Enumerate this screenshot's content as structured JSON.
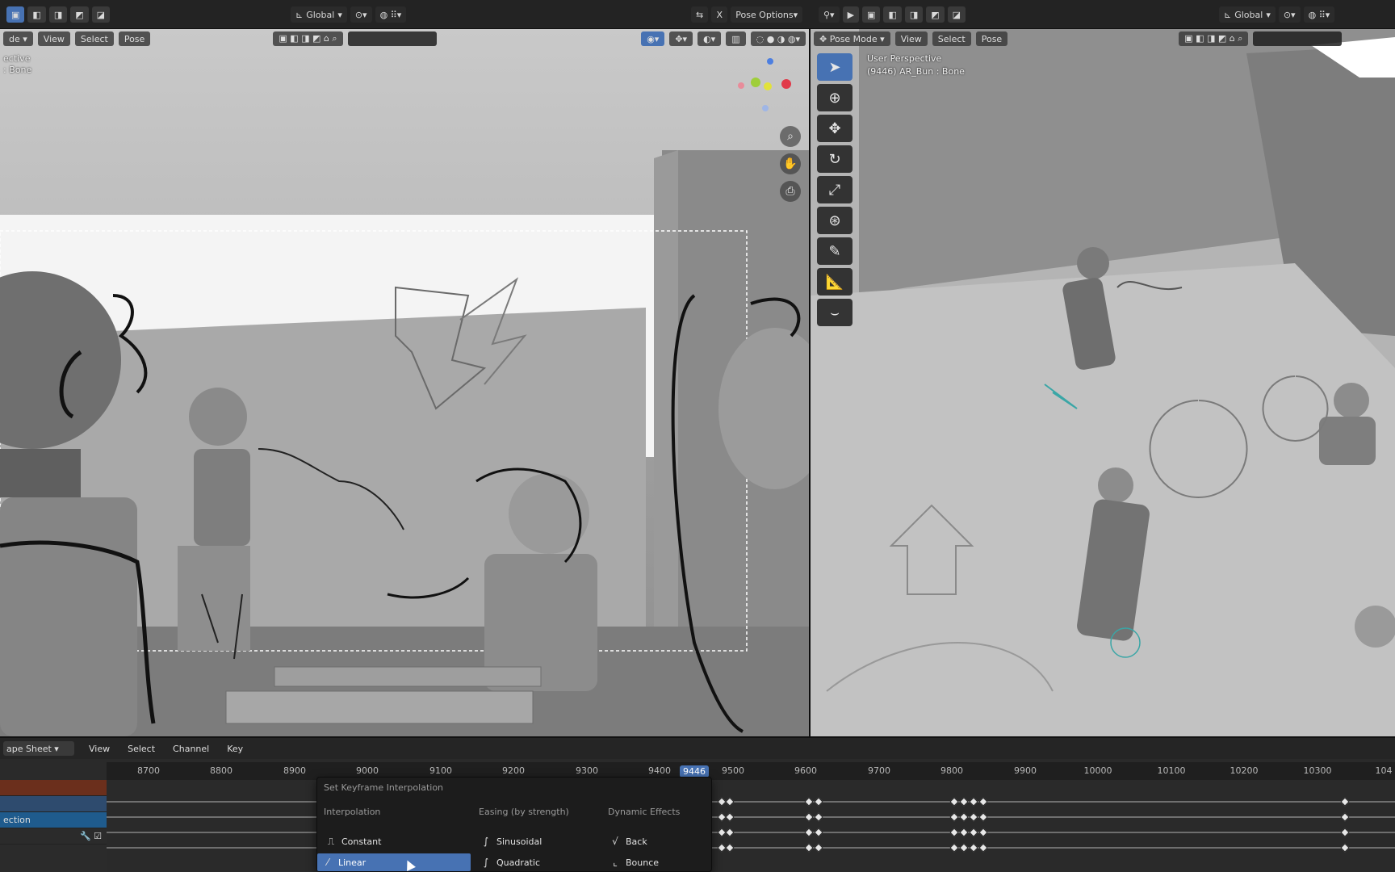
{
  "topbar": {
    "left_orientation": "Global",
    "left_pose_options": "Pose Options",
    "right_orientation": "Global"
  },
  "left_viewport": {
    "header": {
      "mode": "de",
      "view": "View",
      "select": "Select",
      "pose": "Pose"
    },
    "overlay_line1": "ective",
    "overlay_line2": ": Bone"
  },
  "right_viewport": {
    "header": {
      "mode": "Pose Mode",
      "view": "View",
      "select": "Select",
      "pose": "Pose"
    },
    "overlay_line1": "User Perspective",
    "overlay_line2": "(9446) AR_Bun : Bone"
  },
  "timeline": {
    "header": {
      "mode": "ape Sheet",
      "view": "View",
      "select": "Select",
      "channel": "Channel",
      "key": "Key"
    },
    "ticks": [
      "8700",
      "8800",
      "8900",
      "9000",
      "9100",
      "9200",
      "9300",
      "9400",
      "9500",
      "9600",
      "9700",
      "9800",
      "9900",
      "10000",
      "10100",
      "10200",
      "10300",
      "104"
    ],
    "current_frame": "9446",
    "channels": [
      "",
      "",
      "",
      "ection",
      ""
    ]
  },
  "interp_menu": {
    "title": "Set Keyframe Interpolation",
    "col1_header": "Interpolation",
    "col2_header": "Easing (by strength)",
    "col3_header": "Dynamic Effects",
    "constant": "Constant",
    "linear": "Linear",
    "sinusoidal": "Sinusoidal",
    "quadratic": "Quadratic",
    "back": "Back",
    "bounce": "Bounce"
  },
  "colors": {
    "accent": "#4772b3",
    "panel": "#2a2a2a",
    "header": "#232323"
  }
}
